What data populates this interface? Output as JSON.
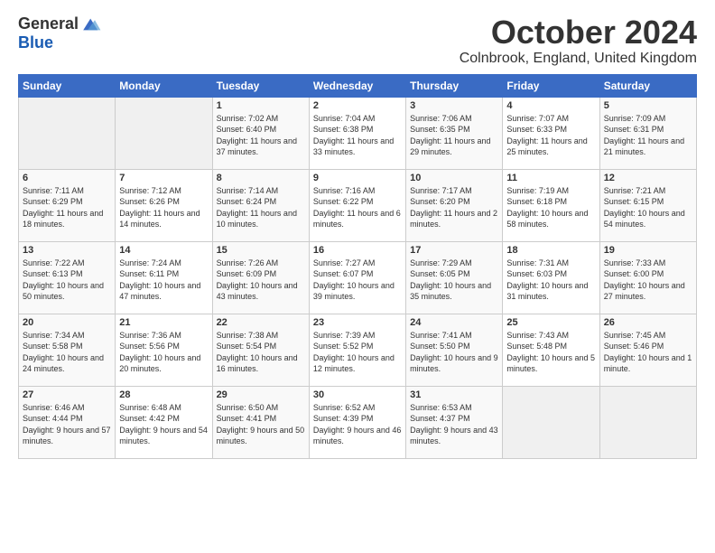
{
  "header": {
    "logo_general": "General",
    "logo_blue": "Blue",
    "month": "October 2024",
    "location": "Colnbrook, England, United Kingdom"
  },
  "days_of_week": [
    "Sunday",
    "Monday",
    "Tuesday",
    "Wednesday",
    "Thursday",
    "Friday",
    "Saturday"
  ],
  "weeks": [
    [
      {
        "day": "",
        "empty": true
      },
      {
        "day": "",
        "empty": true
      },
      {
        "day": "1",
        "sunrise": "7:02 AM",
        "sunset": "6:40 PM",
        "daylight": "11 hours and 37 minutes."
      },
      {
        "day": "2",
        "sunrise": "7:04 AM",
        "sunset": "6:38 PM",
        "daylight": "11 hours and 33 minutes."
      },
      {
        "day": "3",
        "sunrise": "7:06 AM",
        "sunset": "6:35 PM",
        "daylight": "11 hours and 29 minutes."
      },
      {
        "day": "4",
        "sunrise": "7:07 AM",
        "sunset": "6:33 PM",
        "daylight": "11 hours and 25 minutes."
      },
      {
        "day": "5",
        "sunrise": "7:09 AM",
        "sunset": "6:31 PM",
        "daylight": "11 hours and 21 minutes."
      }
    ],
    [
      {
        "day": "6",
        "sunrise": "7:11 AM",
        "sunset": "6:29 PM",
        "daylight": "11 hours and 18 minutes."
      },
      {
        "day": "7",
        "sunrise": "7:12 AM",
        "sunset": "6:26 PM",
        "daylight": "11 hours and 14 minutes."
      },
      {
        "day": "8",
        "sunrise": "7:14 AM",
        "sunset": "6:24 PM",
        "daylight": "11 hours and 10 minutes."
      },
      {
        "day": "9",
        "sunrise": "7:16 AM",
        "sunset": "6:22 PM",
        "daylight": "11 hours and 6 minutes."
      },
      {
        "day": "10",
        "sunrise": "7:17 AM",
        "sunset": "6:20 PM",
        "daylight": "11 hours and 2 minutes."
      },
      {
        "day": "11",
        "sunrise": "7:19 AM",
        "sunset": "6:18 PM",
        "daylight": "10 hours and 58 minutes."
      },
      {
        "day": "12",
        "sunrise": "7:21 AM",
        "sunset": "6:15 PM",
        "daylight": "10 hours and 54 minutes."
      }
    ],
    [
      {
        "day": "13",
        "sunrise": "7:22 AM",
        "sunset": "6:13 PM",
        "daylight": "10 hours and 50 minutes."
      },
      {
        "day": "14",
        "sunrise": "7:24 AM",
        "sunset": "6:11 PM",
        "daylight": "10 hours and 47 minutes."
      },
      {
        "day": "15",
        "sunrise": "7:26 AM",
        "sunset": "6:09 PM",
        "daylight": "10 hours and 43 minutes."
      },
      {
        "day": "16",
        "sunrise": "7:27 AM",
        "sunset": "6:07 PM",
        "daylight": "10 hours and 39 minutes."
      },
      {
        "day": "17",
        "sunrise": "7:29 AM",
        "sunset": "6:05 PM",
        "daylight": "10 hours and 35 minutes."
      },
      {
        "day": "18",
        "sunrise": "7:31 AM",
        "sunset": "6:03 PM",
        "daylight": "10 hours and 31 minutes."
      },
      {
        "day": "19",
        "sunrise": "7:33 AM",
        "sunset": "6:00 PM",
        "daylight": "10 hours and 27 minutes."
      }
    ],
    [
      {
        "day": "20",
        "sunrise": "7:34 AM",
        "sunset": "5:58 PM",
        "daylight": "10 hours and 24 minutes."
      },
      {
        "day": "21",
        "sunrise": "7:36 AM",
        "sunset": "5:56 PM",
        "daylight": "10 hours and 20 minutes."
      },
      {
        "day": "22",
        "sunrise": "7:38 AM",
        "sunset": "5:54 PM",
        "daylight": "10 hours and 16 minutes."
      },
      {
        "day": "23",
        "sunrise": "7:39 AM",
        "sunset": "5:52 PM",
        "daylight": "10 hours and 12 minutes."
      },
      {
        "day": "24",
        "sunrise": "7:41 AM",
        "sunset": "5:50 PM",
        "daylight": "10 hours and 9 minutes."
      },
      {
        "day": "25",
        "sunrise": "7:43 AM",
        "sunset": "5:48 PM",
        "daylight": "10 hours and 5 minutes."
      },
      {
        "day": "26",
        "sunrise": "7:45 AM",
        "sunset": "5:46 PM",
        "daylight": "10 hours and 1 minute."
      }
    ],
    [
      {
        "day": "27",
        "sunrise": "6:46 AM",
        "sunset": "4:44 PM",
        "daylight": "9 hours and 57 minutes."
      },
      {
        "day": "28",
        "sunrise": "6:48 AM",
        "sunset": "4:42 PM",
        "daylight": "9 hours and 54 minutes."
      },
      {
        "day": "29",
        "sunrise": "6:50 AM",
        "sunset": "4:41 PM",
        "daylight": "9 hours and 50 minutes."
      },
      {
        "day": "30",
        "sunrise": "6:52 AM",
        "sunset": "4:39 PM",
        "daylight": "9 hours and 46 minutes."
      },
      {
        "day": "31",
        "sunrise": "6:53 AM",
        "sunset": "4:37 PM",
        "daylight": "9 hours and 43 minutes."
      },
      {
        "day": "",
        "empty": true
      },
      {
        "day": "",
        "empty": true
      }
    ]
  ]
}
